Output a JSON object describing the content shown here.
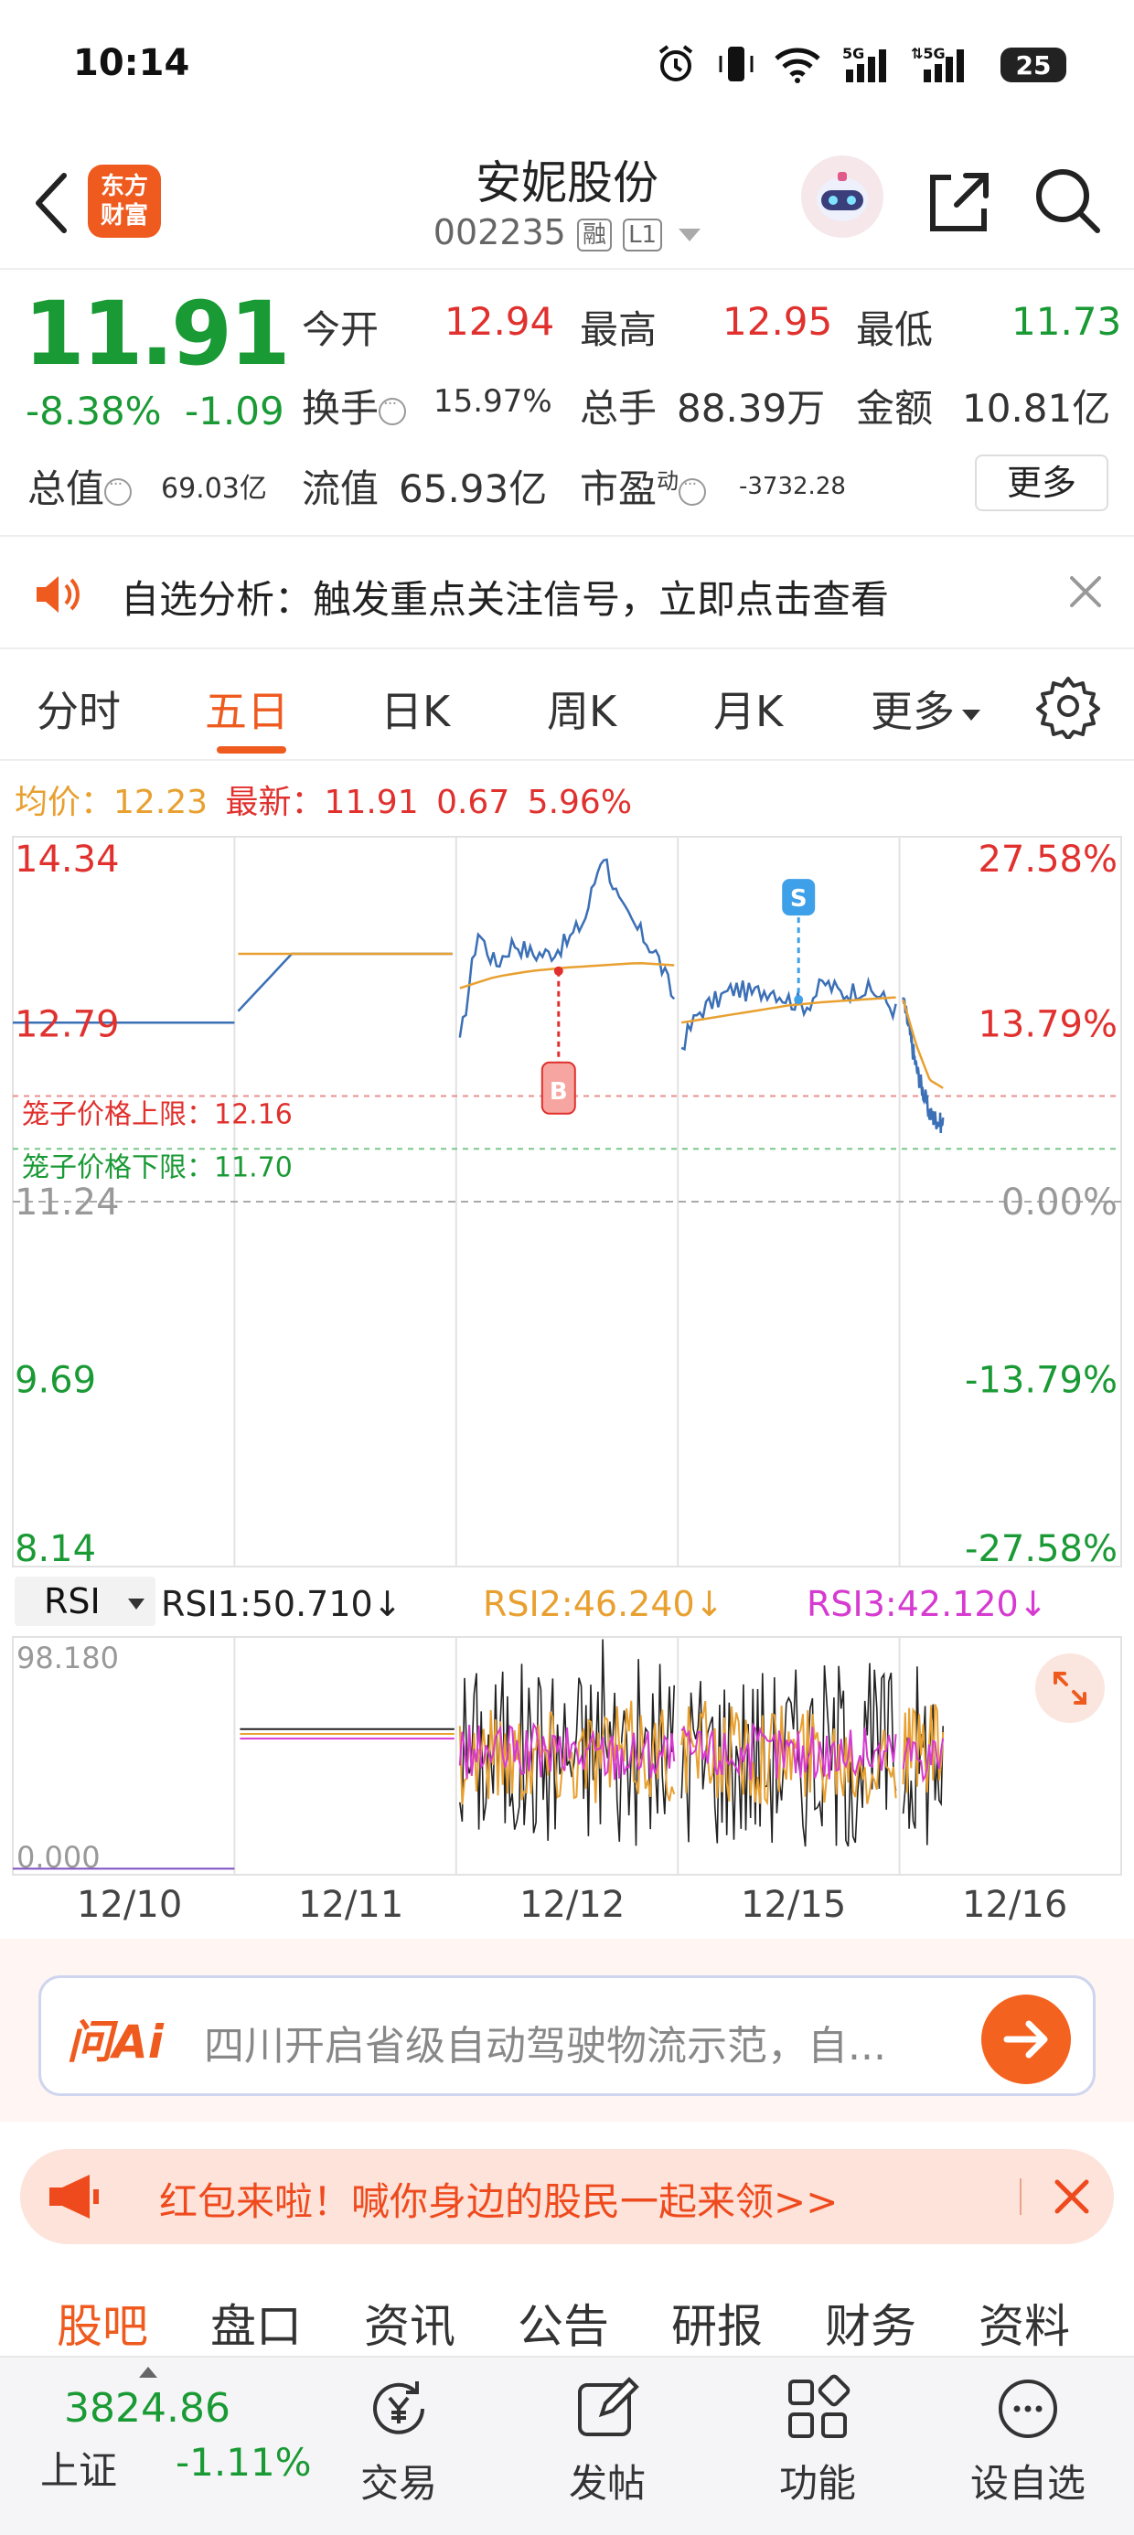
{
  "status": {
    "time": "10:14",
    "battery": "25"
  },
  "header": {
    "logo_text": "东方\n财富",
    "stock_name": "安妮股份",
    "stock_code": "002235",
    "tag_margin": "融",
    "tag_level": "L1"
  },
  "quote": {
    "price": "11.91",
    "change_pct": "-8.38%",
    "change": "-1.09",
    "open_label": "今开",
    "open": "12.94",
    "high_label": "最高",
    "high": "12.95",
    "low_label": "最低",
    "low": "11.73",
    "turnover_label": "换手",
    "turnover": "15.97%",
    "volume_label": "总手",
    "volume": "88.39万",
    "amount_label": "金额",
    "amount": "10.81亿",
    "mktcap_label": "总值",
    "mktcap": "69.03亿",
    "float_label": "流值",
    "float": "65.93亿",
    "pe_label": "市盈",
    "pe_sup": "动",
    "pe": "-3732.28",
    "more": "更多"
  },
  "notice": {
    "text": "自选分析：触发重点关注信号，立即点击查看"
  },
  "chart_tabs": [
    "分时",
    "五日",
    "日K",
    "周K",
    "月K",
    "更多"
  ],
  "chart_header": {
    "avg_label": "均价：",
    "avg": "12.23",
    "latest_label": "最新：",
    "latest": "11.91",
    "latest_change": "0.67",
    "latest_pct": "5.96%"
  },
  "chart_data": {
    "type": "line",
    "y_ticks_left": [
      "14.34",
      "12.79",
      "11.24",
      "9.69",
      "8.14"
    ],
    "y_ticks_right": [
      "27.58%",
      "13.79%",
      "0.00%",
      "-13.79%",
      "-27.58%"
    ],
    "ylim": [
      8.14,
      14.34
    ],
    "upper_limit_label": "笼子价格上限：",
    "upper_limit": "12.16",
    "lower_limit_label": "笼子价格下限：",
    "lower_limit": "11.70",
    "x_days": [
      "12/10",
      "12/11",
      "12/12",
      "12/15",
      "12/16"
    ],
    "markers": [
      {
        "label": "B",
        "day": "12/12"
      },
      {
        "label": "S",
        "day": "12/15"
      }
    ],
    "series": [
      {
        "name": "price",
        "color": "#3b6fb6",
        "days": [
          [
            12.8,
            12.8,
            12.8,
            12.8,
            12.8
          ],
          [
            12.9,
            13.4,
            13.4,
            13.4,
            13.4
          ],
          [
            12.6,
            13.6,
            13.3,
            13.5,
            13.4,
            13.4,
            13.5,
            13.7,
            14.3,
            13.8,
            13.6,
            13.4,
            13.0
          ],
          [
            12.6,
            12.9,
            13.0,
            13.1,
            13.05,
            13.1,
            13.0,
            12.95,
            13.15,
            13.05,
            13.1,
            13.05,
            12.9
          ],
          [
            13.0,
            12.4,
            12.0,
            11.91
          ]
        ]
      },
      {
        "name": "avg",
        "color": "#e8a030",
        "days": [
          [],
          [
            13.4,
            13.4,
            13.4
          ],
          [
            13.1,
            13.2,
            13.25,
            13.28,
            13.3,
            13.32,
            13.3
          ],
          [
            12.8,
            12.85,
            12.9,
            12.95,
            12.98,
            13.0,
            13.02
          ],
          [
            13.0,
            12.6,
            12.3,
            12.23
          ]
        ]
      }
    ]
  },
  "rsi": {
    "selector": "RSI",
    "rsi1": "RSI1:50.710↓",
    "rsi2": "RSI2:46.240↓",
    "rsi3": "RSI3:42.120↓",
    "y_max": "98.180",
    "y_min": "0.000",
    "colors": {
      "rsi1": "#222222",
      "rsi2": "#e8a030",
      "rsi3": "#d63ad0"
    }
  },
  "ai": {
    "logo": "问Ai",
    "text": "四川开启省级自动驾驶物流示范，自..."
  },
  "promo": {
    "text": "红包来啦！喊你身边的股民一起来领>>"
  },
  "section_tabs": [
    "股吧",
    "盘口",
    "资讯",
    "公告",
    "研报",
    "财务",
    "资料"
  ],
  "bottom_nav": {
    "index_value": "3824.86",
    "index_name": "上证",
    "index_pct": "-1.11%",
    "items": [
      "交易",
      "发帖",
      "功能",
      "设自选"
    ]
  }
}
